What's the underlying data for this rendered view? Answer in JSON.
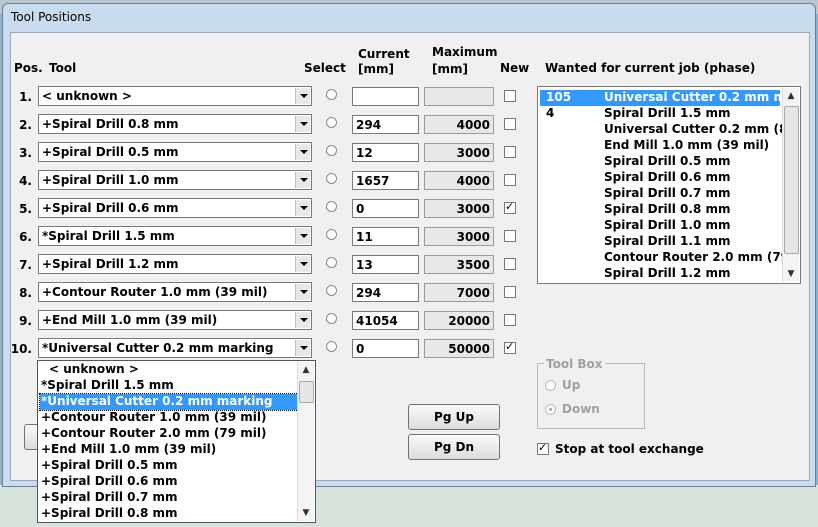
{
  "window": {
    "title": "Tool Positions"
  },
  "headers": {
    "pos": "Pos.",
    "tool": "Tool",
    "select": "Select",
    "current": "Current",
    "current_unit": "[mm]",
    "maximum": "Maximum",
    "maximum_unit": "[mm]",
    "new": "New",
    "wanted": "Wanted for current job (phase)"
  },
  "rows": [
    {
      "pos": "1.",
      "tool": "< unknown >",
      "current": "",
      "maximum": "",
      "new": false
    },
    {
      "pos": "2.",
      "tool": "+Spiral Drill 0.8 mm",
      "current": "294",
      "maximum": "4000",
      "new": false
    },
    {
      "pos": "3.",
      "tool": "+Spiral Drill 0.5 mm",
      "current": "12",
      "maximum": "3000",
      "new": false
    },
    {
      "pos": "4.",
      "tool": "+Spiral Drill 1.0 mm",
      "current": "1657",
      "maximum": "4000",
      "new": false
    },
    {
      "pos": "5.",
      "tool": "+Spiral Drill 0.6 mm",
      "current": "0",
      "maximum": "3000",
      "new": true
    },
    {
      "pos": "6.",
      "tool": "*Spiral Drill 1.5 mm",
      "current": "11",
      "maximum": "3000",
      "new": false
    },
    {
      "pos": "7.",
      "tool": "+Spiral Drill 1.2 mm",
      "current": "13",
      "maximum": "3500",
      "new": false
    },
    {
      "pos": "8.",
      "tool": "+Contour Router 1.0 mm (39 mil)",
      "current": "294",
      "maximum": "7000",
      "new": false
    },
    {
      "pos": "9.",
      "tool": "+End Mill 1.0 mm (39 mil)",
      "current": "41054",
      "maximum": "20000",
      "new": false
    },
    {
      "pos": "10.",
      "tool": "*Universal Cutter 0.2 mm marking",
      "current": "0",
      "maximum": "50000",
      "new": true
    }
  ],
  "wanted_list": [
    {
      "qty": "105",
      "name": "Universal Cutter 0.2 mm ma",
      "selected": true
    },
    {
      "qty": "4",
      "name": "Spiral Drill 1.5 mm",
      "selected": false
    },
    {
      "qty": "",
      "name": "Universal Cutter 0.2 mm (8",
      "selected": false
    },
    {
      "qty": "",
      "name": "End Mill 1.0 mm (39 mil)",
      "selected": false
    },
    {
      "qty": "",
      "name": "Spiral Drill 0.5 mm",
      "selected": false
    },
    {
      "qty": "",
      "name": "Spiral Drill 0.6 mm",
      "selected": false
    },
    {
      "qty": "",
      "name": "Spiral Drill 0.7 mm",
      "selected": false
    },
    {
      "qty": "",
      "name": "Spiral Drill 0.8 mm",
      "selected": false
    },
    {
      "qty": "",
      "name": "Spiral Drill 1.0 mm",
      "selected": false
    },
    {
      "qty": "",
      "name": "Spiral Drill 1.1 mm",
      "selected": false
    },
    {
      "qty": "",
      "name": "Contour Router 2.0 mm (79",
      "selected": false
    },
    {
      "qty": "",
      "name": "Spiral Drill 1.2 mm",
      "selected": false
    }
  ],
  "dropdown_options": [
    {
      "label": "< unknown >",
      "selected": false
    },
    {
      "label": "*Spiral Drill 1.5 mm",
      "selected": false
    },
    {
      "label": "*Universal Cutter 0.2 mm marking",
      "selected": true
    },
    {
      "label": "+Contour Router 1.0 mm (39 mil)",
      "selected": false
    },
    {
      "label": "+Contour Router 2.0 mm (79 mil)",
      "selected": false
    },
    {
      "label": "+End Mill 1.0 mm (39 mil)",
      "selected": false
    },
    {
      "label": "+Spiral Drill 0.5 mm",
      "selected": false
    },
    {
      "label": "+Spiral Drill 0.6 mm",
      "selected": false
    },
    {
      "label": "+Spiral Drill 0.7 mm",
      "selected": false
    },
    {
      "label": "+Spiral Drill 0.8 mm",
      "selected": false
    }
  ],
  "buttons": {
    "pg_up": "Pg Up",
    "pg_dn": "Pg Dn"
  },
  "toolbox": {
    "label": "Tool Box",
    "up": "Up",
    "down": "Down",
    "selected": "Down"
  },
  "stop_at_exchange": {
    "label": "Stop at tool exchange",
    "checked": true
  },
  "colors": {
    "selection": "#3399ff",
    "window_frame": "#c9dcef"
  }
}
